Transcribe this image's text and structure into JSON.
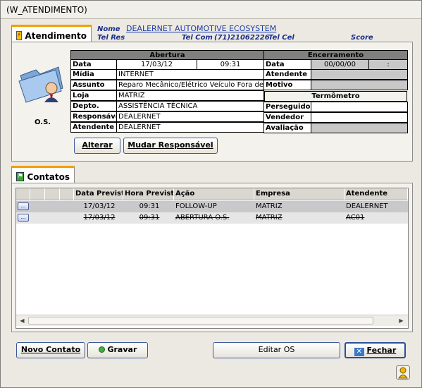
{
  "window": {
    "title": "(W_ATENDIMENTO)"
  },
  "tab_atendimento": {
    "label": "Atendimento"
  },
  "header": {
    "nome_label": "Nome",
    "nome_value": "DEALERNET AUTOMOTIVE ECOSYSTEM",
    "telres_label": "Tel Res",
    "telcom_label": "Tel Com",
    "telcom_value": "(71)21062226",
    "telcel_label": "Tel Cel",
    "score_label": "Score"
  },
  "os_label": "O.S.",
  "abertura": {
    "title": "Abertura",
    "data_label": "Data",
    "data_value": "17/03/12",
    "hora_value": "09:31",
    "midia_label": "Mídia",
    "midia_value": "INTERNET",
    "assunto_label": "Assunto",
    "assunto_value": "Reparo Mecânico/Elétrico Veículo Fora de",
    "loja_label": "Loja",
    "loja_value": "MATRIZ",
    "depto_label": "Depto.",
    "depto_value": "ASSISTÊNCIA TÉCNICA",
    "responsavel_label": "Responsável",
    "responsavel_value": "DEALERNET",
    "atendente_label": "Atendente",
    "atendente_value": "DEALERNET"
  },
  "encerramento": {
    "title": "Encerramento",
    "data_label": "Data",
    "data_value": "00/00/00",
    "hora_value": ":",
    "atendente_label": "Atendente",
    "motivo_label": "Motivo"
  },
  "termometro": {
    "title": "Termômetro",
    "perseguidor_label": "Perseguidor",
    "vendedor_label": "Vendedor",
    "avaliacao_label": "Avaliação"
  },
  "buttons": {
    "alterar": "Alterar",
    "mudar_responsavel": "Mudar Responsável",
    "novo_contato": "Novo Contato",
    "gravar": "Gravar",
    "editar_os": "Editar OS",
    "fechar": "Fechar"
  },
  "tab_contatos": {
    "label": "Contatos"
  },
  "contatos": {
    "columns": [
      "Data Prevista",
      "Hora Prevista",
      "Ação",
      "Empresa",
      "Atendente"
    ],
    "rows": [
      {
        "data": "17/03/12",
        "hora": "09:31",
        "acao": "FOLLOW-UP",
        "empresa": "MATRIZ",
        "atendente": "DEALERNET",
        "button": "..."
      },
      {
        "data": "17/03/12",
        "hora": "09:31",
        "acao": "ABERTURA O.S.",
        "empresa": "MATRIZ",
        "atendente": "AC01",
        "button": "..."
      }
    ]
  }
}
